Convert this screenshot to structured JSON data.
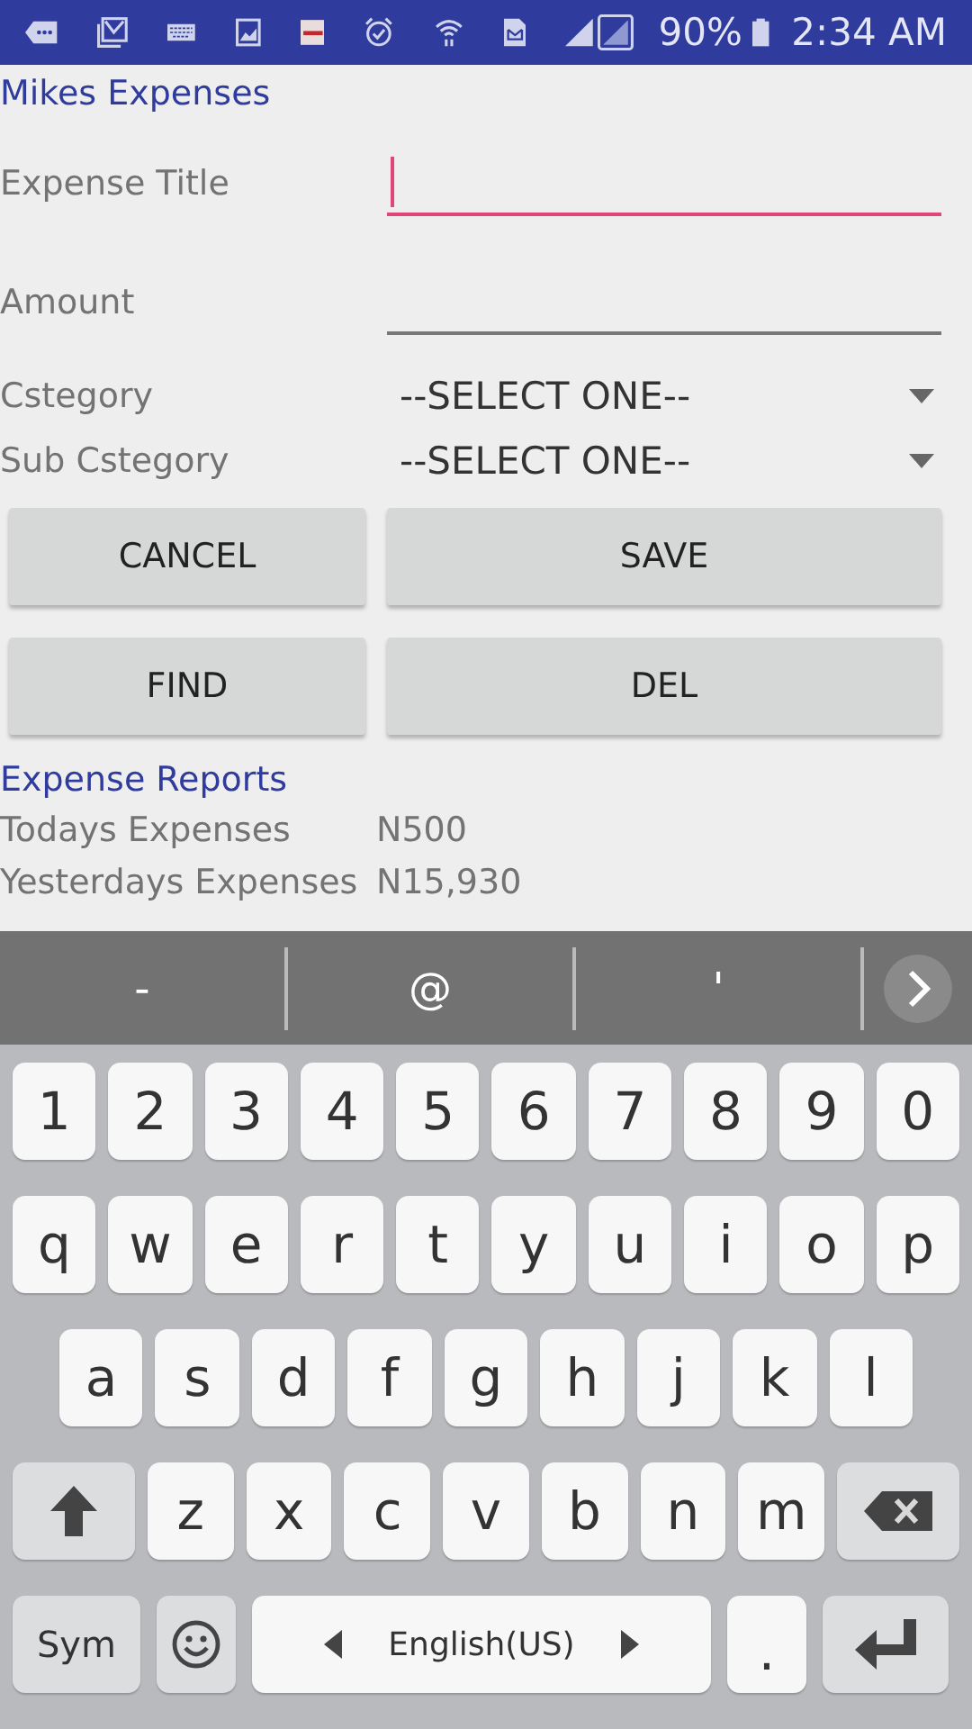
{
  "status_bar": {
    "battery": "90%",
    "time": "2:34 AM"
  },
  "app": {
    "title": "Mikes Expenses",
    "fields": [
      {
        "kind": "input",
        "label": "Expense Title",
        "focused": true
      },
      {
        "kind": "input",
        "label": "Amount",
        "focused": false
      },
      {
        "kind": "select",
        "label": "Cstegory",
        "value": "--SELECT ONE--"
      },
      {
        "kind": "select",
        "label": "Sub Cstegory",
        "value": "--SELECT ONE--"
      }
    ],
    "buttons": [
      [
        "CANCEL",
        "SAVE"
      ],
      [
        "FIND",
        "DEL"
      ]
    ],
    "reports": {
      "title": "Expense Reports",
      "rows": [
        {
          "label": "Todays Expenses",
          "value": "N500"
        },
        {
          "label": "Yesterdays Expenses",
          "value": "N15,930"
        }
      ]
    }
  },
  "keyboard": {
    "suggestions": [
      "-",
      "@",
      "'"
    ],
    "rows": [
      {
        "keys": [
          {
            "kind": "char",
            "label": "1"
          },
          {
            "kind": "char",
            "label": "2"
          },
          {
            "kind": "char",
            "label": "3"
          },
          {
            "kind": "char",
            "label": "4"
          },
          {
            "kind": "char",
            "label": "5"
          },
          {
            "kind": "char",
            "label": "6"
          },
          {
            "kind": "char",
            "label": "7"
          },
          {
            "kind": "char",
            "label": "8"
          },
          {
            "kind": "char",
            "label": "9"
          },
          {
            "kind": "char",
            "label": "0"
          }
        ]
      },
      {
        "keys": [
          {
            "kind": "char",
            "label": "q"
          },
          {
            "kind": "char",
            "label": "w"
          },
          {
            "kind": "char",
            "label": "e"
          },
          {
            "kind": "char",
            "label": "r"
          },
          {
            "kind": "char",
            "label": "t"
          },
          {
            "kind": "char",
            "label": "y"
          },
          {
            "kind": "char",
            "label": "u"
          },
          {
            "kind": "char",
            "label": "i"
          },
          {
            "kind": "char",
            "label": "o"
          },
          {
            "kind": "char",
            "label": "p"
          }
        ]
      },
      {
        "keys": [
          {
            "kind": "char",
            "label": "a"
          },
          {
            "kind": "char",
            "label": "s"
          },
          {
            "kind": "char",
            "label": "d"
          },
          {
            "kind": "char",
            "label": "f"
          },
          {
            "kind": "char",
            "label": "g"
          },
          {
            "kind": "char",
            "label": "h"
          },
          {
            "kind": "char",
            "label": "j"
          },
          {
            "kind": "char",
            "label": "k"
          },
          {
            "kind": "char",
            "label": "l"
          }
        ]
      },
      {
        "keys": [
          {
            "kind": "shift"
          },
          {
            "kind": "char",
            "label": "z"
          },
          {
            "kind": "char",
            "label": "x"
          },
          {
            "kind": "char",
            "label": "c"
          },
          {
            "kind": "char",
            "label": "v"
          },
          {
            "kind": "char",
            "label": "b"
          },
          {
            "kind": "char",
            "label": "n"
          },
          {
            "kind": "char",
            "label": "m"
          },
          {
            "kind": "backspace"
          }
        ]
      },
      {
        "keys": [
          {
            "kind": "sym",
            "label": "Sym"
          },
          {
            "kind": "emoji"
          },
          {
            "kind": "space",
            "label": "English(US)"
          },
          {
            "kind": "period",
            "label": "."
          },
          {
            "kind": "enter"
          }
        ]
      }
    ]
  }
}
